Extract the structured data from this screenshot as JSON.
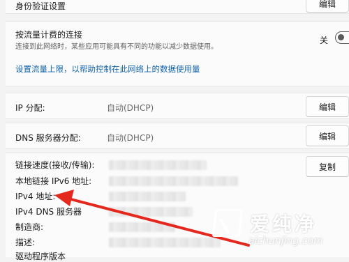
{
  "identity": {
    "label": "身份验证设置",
    "button": "编辑"
  },
  "metered": {
    "label": "按流量计费的连接",
    "desc": "连接到此网络时，某些应用可能具有不同的功能以减少数据使用。",
    "toggle_state": "关"
  },
  "data_limit_link": "设置流量上限，以帮助控制在此网络上的数据使用量",
  "ip": {
    "label": "IP 分配:",
    "value": "自动(DHCP)",
    "button": "编辑"
  },
  "dns": {
    "label": "DNS 服务器分配:",
    "value": "自动(DHCP)",
    "button": "编辑"
  },
  "properties": {
    "copy_button": "复制",
    "rows": [
      "链接速度(接收/传输):",
      "本地链接 IPv6 地址:",
      "IPv4 地址:",
      "IPv4 DNS 服务器",
      "制造商:",
      "描述:",
      "驱动程序版本"
    ]
  },
  "watermark": {
    "brand": "爱纯净",
    "url": "aichunjing.com"
  },
  "colors": {
    "link": "#0f62a8",
    "arrow": "#e5281d",
    "watermark": "#ffffff"
  }
}
